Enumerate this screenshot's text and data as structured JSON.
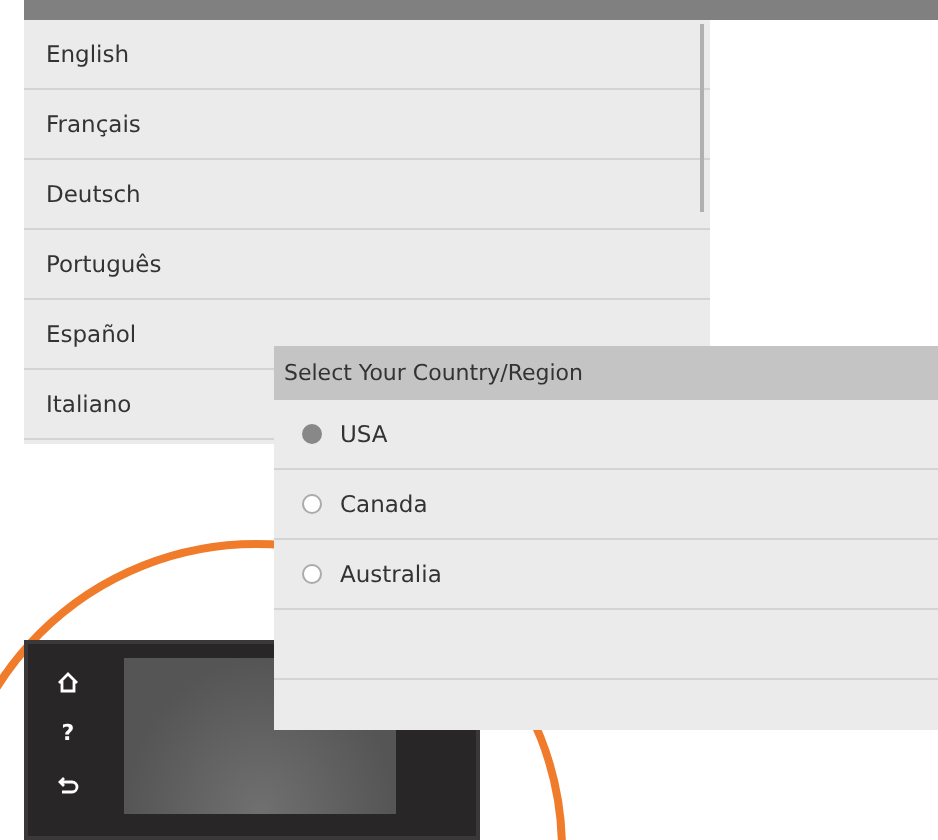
{
  "language_list": {
    "items": [
      "English",
      "Français",
      "Deutsch",
      "Português",
      "Español",
      "Italiano"
    ]
  },
  "country_dialog": {
    "title": "Select Your Country/Region",
    "options": [
      {
        "label": "USA",
        "selected": true
      },
      {
        "label": "Canada",
        "selected": false
      },
      {
        "label": "Australia",
        "selected": false
      }
    ]
  },
  "control_panel": {
    "help_key": "?"
  }
}
